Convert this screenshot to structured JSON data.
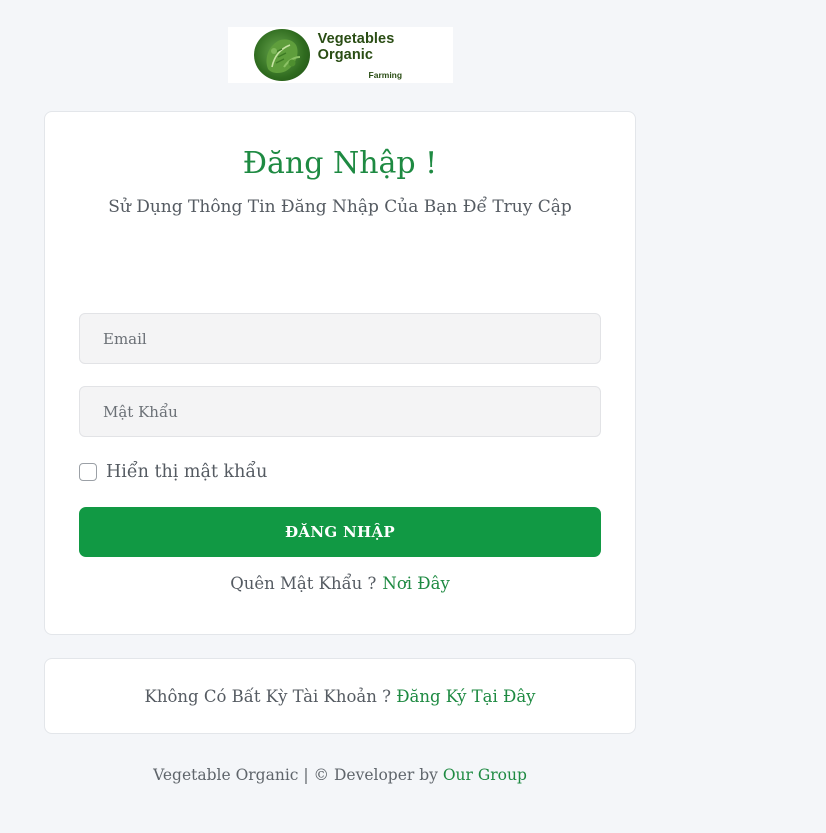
{
  "logo": {
    "title": "Vegetables Organic",
    "subtitle": "Farming",
    "icon": "leafy-vegetable-icon",
    "color": "#2a4d14"
  },
  "login": {
    "heading": "Đăng Nhập !",
    "subheading": "Sử Dụng Thông Tin Đăng Nhập Của Bạn Để Truy Cập",
    "email_placeholder": "Email",
    "email_value": "",
    "password_placeholder": "Mật Khẩu",
    "password_value": "",
    "show_password_label": "Hiển thị mật khẩu",
    "show_password_checked": false,
    "submit_label": "ĐĂNG NHẬP",
    "forgot_text": "Quên Mật Khẩu ?",
    "forgot_link": "Nơi Đây"
  },
  "signup": {
    "text": "Không Có Bất Kỳ Tài Khoản ?",
    "link": "Đăng Ký Tại Đây"
  },
  "footer": {
    "text": "Vegetable Organic | © Developer by",
    "link": "Our Group"
  },
  "colors": {
    "accent": "#1e8a42",
    "button": "#119944",
    "background": "#f4f6f9",
    "card": "#ffffff"
  }
}
